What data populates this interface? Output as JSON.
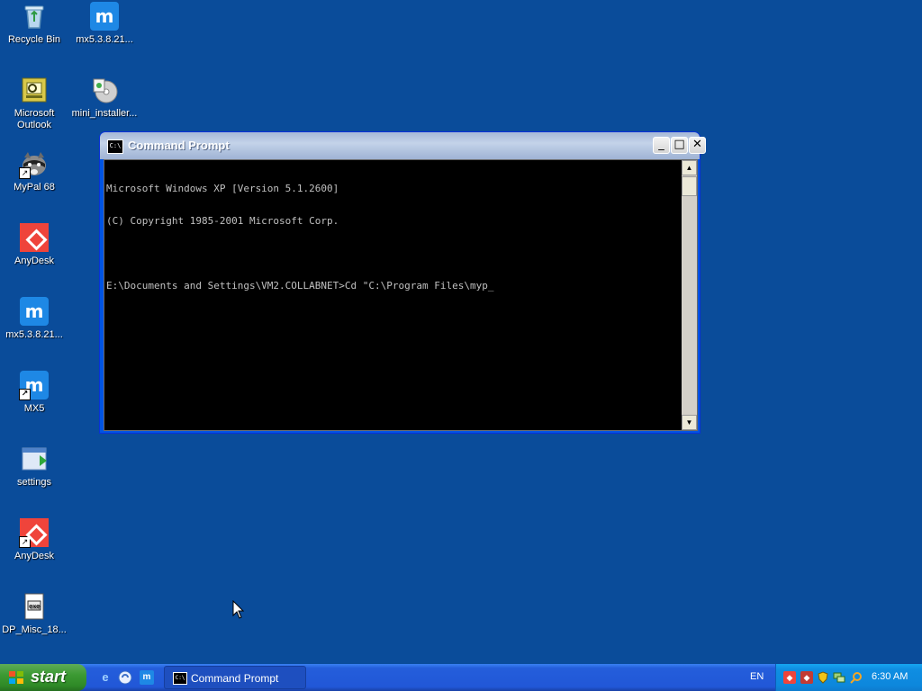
{
  "desktop": {
    "icons": [
      {
        "label": "Recycle Bin"
      },
      {
        "label": "mx5.3.8.21..."
      },
      {
        "label": "Microsoft Outlook"
      },
      {
        "label": "mini_installer..."
      },
      {
        "label": "MyPal 68"
      },
      {
        "label": "AnyDesk"
      },
      {
        "label": "mx5.3.8.21..."
      },
      {
        "label": "MX5"
      },
      {
        "label": "settings"
      },
      {
        "label": "AnyDesk"
      },
      {
        "label": "DP_Misc_18..."
      }
    ]
  },
  "window": {
    "title": "Command Prompt",
    "icon_text": "C:\\",
    "buttons": {
      "minimize": "_",
      "maximize": "□",
      "close": "✕"
    },
    "console_lines": [
      "Microsoft Windows XP [Version 5.1.2600]",
      "(C) Copyright 1985-2001 Microsoft Corp.",
      "",
      "E:\\Documents and Settings\\VM2.COLLABNET>Cd \"C:\\Program Files\\myp_"
    ]
  },
  "taskbar": {
    "start_label": "start",
    "task_label": "Command Prompt",
    "language": "EN",
    "clock": "6:30 AM",
    "quick_launch": [
      "ie-icon",
      "show-desktop-icon",
      "maxthon-icon"
    ],
    "tray_icons": [
      "anydesk-tray-icon",
      "anydesk-tray-icon-2",
      "security-shield-icon",
      "network-icon",
      "search-icon"
    ]
  },
  "colors": {
    "desktop": "#0a4c9a",
    "console_bg": "#000000",
    "console_text": "#c0c0c0",
    "taskbar": "#245edb",
    "start_button": "#3c9a33"
  }
}
